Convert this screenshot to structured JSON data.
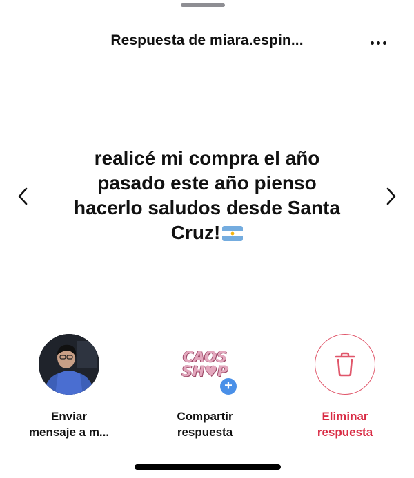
{
  "header": {
    "title": "Respuesta de miara.espin..."
  },
  "message": {
    "lines": [
      "realicé mi compra el año",
      "pasado este año pienso",
      "hacerlo saludos desde Santa",
      "Cruz!"
    ],
    "flag": "argentina-flag-icon"
  },
  "actions": {
    "send": {
      "label_line1": "Enviar",
      "label_line2": "mensaje a m..."
    },
    "share": {
      "label_line1": "Compartir",
      "label_line2": "respuesta",
      "logo_line1": "CAOS",
      "logo_line2": "SH♥P",
      "badge": "+"
    },
    "delete": {
      "label_line1": "Eliminar",
      "label_line2": "respuesta"
    }
  },
  "colors": {
    "delete_red": "#d92c45",
    "badge_blue": "#4a90e8",
    "logo_pink": "#e3a7bd"
  },
  "icons": {
    "more": "more-horizontal-icon",
    "prev": "chevron-left-icon",
    "next": "chevron-right-icon",
    "delete": "trash-icon"
  }
}
